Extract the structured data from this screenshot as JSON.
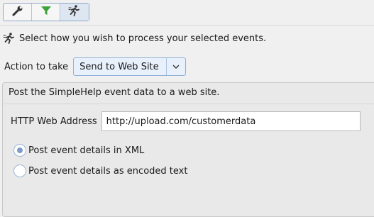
{
  "toolbar": {
    "tools": [
      {
        "name": "wrench-icon",
        "active": false
      },
      {
        "name": "filter-icon",
        "active": false
      },
      {
        "name": "runner-icon",
        "active": true
      }
    ]
  },
  "intro": {
    "icon": "runner-icon",
    "text": "Select how you wish to process your selected events."
  },
  "action": {
    "label": "Action to take",
    "selected": "Send to Web Site"
  },
  "panel": {
    "description": "Post the SimpleHelp event data to a web site.",
    "http_label": "HTTP Web Address",
    "http_value": "http://upload.com/customerdata",
    "radio_options": [
      {
        "label": "Post event details in XML",
        "checked": true
      },
      {
        "label": "Post event details as encoded text",
        "checked": false
      }
    ]
  },
  "colors": {
    "accent": "#7b9cc7",
    "filter_green": "#3aa23a"
  }
}
